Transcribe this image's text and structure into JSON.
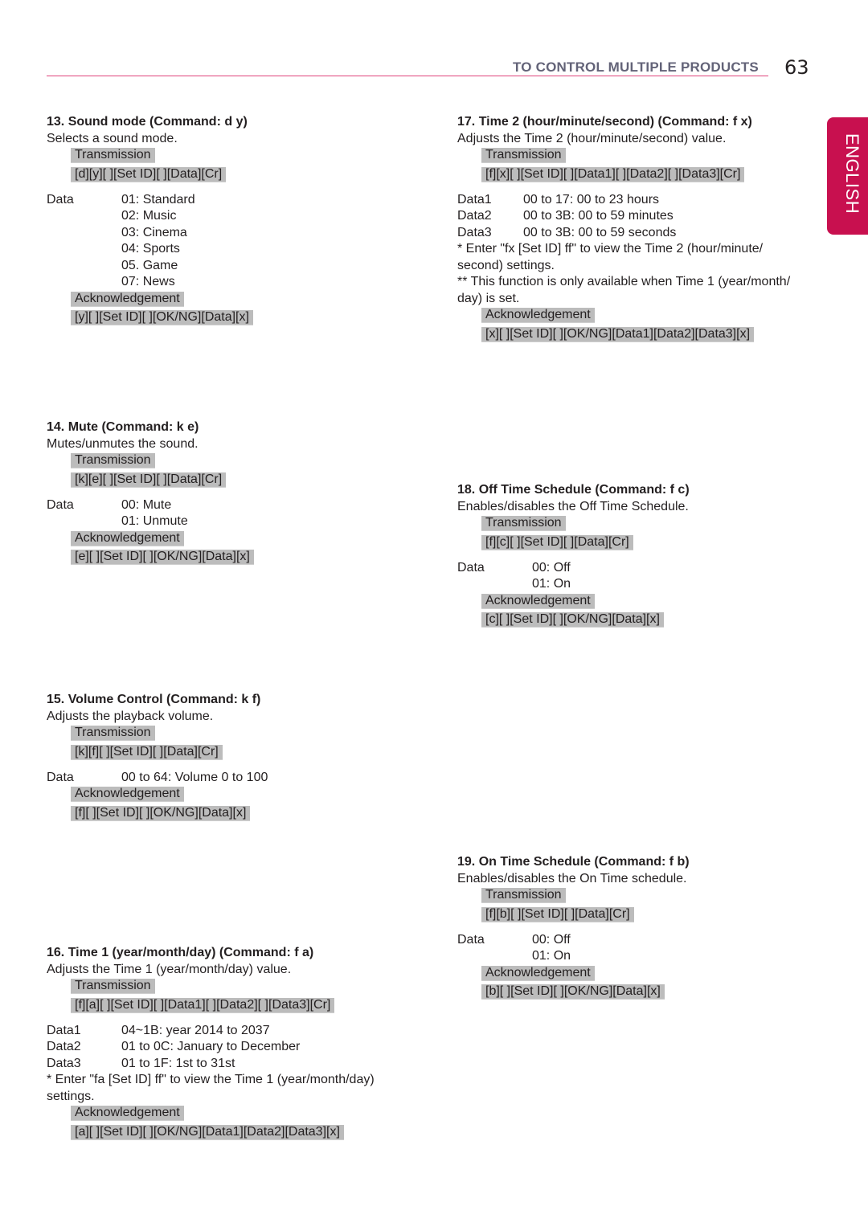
{
  "header": {
    "title": "TO CONTROL MULTIPLE PRODUCTS",
    "page_number": "63",
    "language_tab": "ENGLISH",
    "accent_color": "#c8104f"
  },
  "labels": {
    "transmission": "Transmission",
    "acknowledgement": "Acknowledgement"
  },
  "sections": {
    "s13": {
      "title": "13. Sound mode (Command: d y)",
      "description": "Selects a sound mode.",
      "transmission_code": "[d][y][ ][Set ID][ ][Data][Cr]",
      "data": [
        {
          "label": "Data",
          "value": "01: Standard"
        },
        {
          "label": "",
          "value": "02: Music"
        },
        {
          "label": "",
          "value": "03: Cinema"
        },
        {
          "label": "",
          "value": "04: Sports"
        },
        {
          "label": "",
          "value": "05. Game"
        },
        {
          "label": "",
          "value": "07: News"
        }
      ],
      "ack_code": "[y][ ][Set ID][ ][OK/NG][Data][x]"
    },
    "s14": {
      "title": "14. Mute (Command: k e)",
      "description": "Mutes/unmutes the sound.",
      "transmission_code": "[k][e][ ][Set ID][ ][Data][Cr]",
      "data": [
        {
          "label": "Data",
          "value": "00: Mute"
        },
        {
          "label": "",
          "value": "01: Unmute"
        }
      ],
      "ack_code": "[e][ ][Set ID][ ][OK/NG][Data][x]"
    },
    "s15": {
      "title": "15. Volume Control (Command: k f)",
      "description": "Adjusts the playback volume.",
      "transmission_code": "[k][f][ ][Set ID][ ][Data][Cr]",
      "data": [
        {
          "label": "Data",
          "value": "00 to 64: Volume 0 to 100"
        }
      ],
      "ack_code": "[f][ ][Set ID][ ][OK/NG][Data][x]"
    },
    "s16": {
      "title": "16. Time 1 (year/month/day) (Command: f a)",
      "description": "Adjusts the Time 1 (year/month/day) value.",
      "transmission_code": "[f][a][ ][Set ID][ ][Data1][ ][Data2][ ][Data3][Cr]",
      "data": [
        {
          "label": "Data1",
          "value": "04~1B: year 2014 to 2037"
        },
        {
          "label": "Data2",
          "value": "01 to 0C: January to December"
        },
        {
          "label": "Data3",
          "value": "01 to 1F: 1st to 31st"
        }
      ],
      "notes": [
        "* Enter \"fa [Set ID] ff\" to view the Time 1 (year/month/day) settings."
      ],
      "ack_code": "[a][ ][Set ID][ ][OK/NG][Data1][Data2][Data3][x]"
    },
    "s17": {
      "title": "17. Time 2 (hour/minute/second) (Command: f x)",
      "description": "Adjusts the Time 2 (hour/minute/second) value.",
      "transmission_code": "[f][x][ ][Set ID][ ][Data1][ ][Data2][ ][Data3][Cr]",
      "data": [
        {
          "label": "Data1",
          "value": "00 to 17: 00 to 23 hours"
        },
        {
          "label": "Data2",
          "value": "00 to 3B: 00 to 59 minutes"
        },
        {
          "label": "Data3",
          "value": "00 to 3B: 00 to 59 seconds"
        }
      ],
      "notes": [
        "* Enter \"fx [Set ID] ff\" to view the Time 2 (hour/minute/ second) settings.",
        "** This function is only available when Time 1 (year/month/ day) is set."
      ],
      "ack_code": "[x][ ][Set ID][ ][OK/NG][Data1][Data2][Data3][x]"
    },
    "s18": {
      "title": "18. Off Time Schedule (Command: f c)",
      "description": "Enables/disables the Off Time Schedule.",
      "transmission_code": "[f][c][ ][Set ID][ ][Data][Cr]",
      "data": [
        {
          "label": "Data",
          "value": "00: Off"
        },
        {
          "label": "",
          "value": "01: On"
        }
      ],
      "ack_code": "[c][ ][Set ID][ ][OK/NG][Data][x]"
    },
    "s19": {
      "title": "19. On Time Schedule (Command: f b)",
      "description": "Enables/disables the On Time schedule.",
      "transmission_code": "[f][b][ ][Set ID][ ][Data][Cr]",
      "data": [
        {
          "label": "Data",
          "value": "00: Off"
        },
        {
          "label": "",
          "value": "01: On"
        }
      ],
      "ack_code": "[b][ ][Set ID][ ][OK/NG][Data][x]"
    }
  }
}
